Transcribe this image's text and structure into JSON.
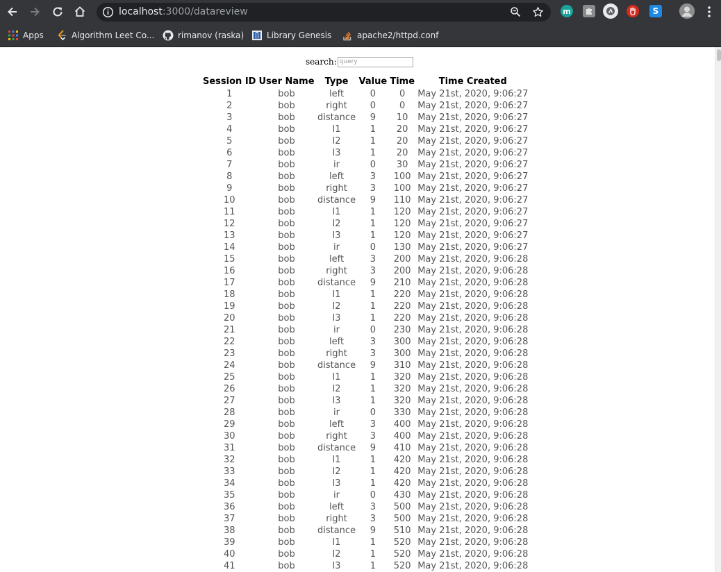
{
  "browser": {
    "url_host": "localhost",
    "url_path": ":3000/datareview",
    "bookmarks": [
      {
        "label": "Apps",
        "icon": "apps-grid-icon"
      },
      {
        "label": "Algorithm Leet Co...",
        "icon": "leetcode-icon"
      },
      {
        "label": "rimanov (raska)",
        "icon": "github-icon"
      },
      {
        "label": "Library Genesis",
        "icon": "library-genesis-icon"
      },
      {
        "label": "apache2/httpd.conf",
        "icon": "stackoverflow-icon"
      }
    ],
    "extensions": [
      {
        "name": "m-extension-icon",
        "letter": "m",
        "color": "#1aa39a"
      },
      {
        "name": "puzzle-extension-icon",
        "letter": "",
        "color": "#8a8b8d"
      },
      {
        "name": "circle-extension-icon",
        "letter": "",
        "color": "#e8eaed"
      },
      {
        "name": "stop-hand-extension-icon",
        "letter": "",
        "color": "#d52b1e"
      },
      {
        "name": "s-extension-icon",
        "letter": "S",
        "color": "#1e88e5"
      }
    ]
  },
  "search": {
    "label": "search:",
    "placeholder": "query"
  },
  "table": {
    "headers": [
      "Session ID",
      "User Name",
      "Type",
      "Value",
      "Time",
      "Time Created"
    ],
    "rows": [
      [
        "1",
        "bob",
        "left",
        "0",
        "0",
        "May 21st, 2020, 9:06:27"
      ],
      [
        "2",
        "bob",
        "right",
        "0",
        "0",
        "May 21st, 2020, 9:06:27"
      ],
      [
        "3",
        "bob",
        "distance",
        "9",
        "10",
        "May 21st, 2020, 9:06:27"
      ],
      [
        "4",
        "bob",
        "l1",
        "1",
        "20",
        "May 21st, 2020, 9:06:27"
      ],
      [
        "5",
        "bob",
        "l2",
        "1",
        "20",
        "May 21st, 2020, 9:06:27"
      ],
      [
        "6",
        "bob",
        "l3",
        "1",
        "20",
        "May 21st, 2020, 9:06:27"
      ],
      [
        "7",
        "bob",
        "ir",
        "0",
        "30",
        "May 21st, 2020, 9:06:27"
      ],
      [
        "8",
        "bob",
        "left",
        "3",
        "100",
        "May 21st, 2020, 9:06:27"
      ],
      [
        "9",
        "bob",
        "right",
        "3",
        "100",
        "May 21st, 2020, 9:06:27"
      ],
      [
        "10",
        "bob",
        "distance",
        "9",
        "110",
        "May 21st, 2020, 9:06:27"
      ],
      [
        "11",
        "bob",
        "l1",
        "1",
        "120",
        "May 21st, 2020, 9:06:27"
      ],
      [
        "12",
        "bob",
        "l2",
        "1",
        "120",
        "May 21st, 2020, 9:06:27"
      ],
      [
        "13",
        "bob",
        "l3",
        "1",
        "120",
        "May 21st, 2020, 9:06:27"
      ],
      [
        "14",
        "bob",
        "ir",
        "0",
        "130",
        "May 21st, 2020, 9:06:27"
      ],
      [
        "15",
        "bob",
        "left",
        "3",
        "200",
        "May 21st, 2020, 9:06:28"
      ],
      [
        "16",
        "bob",
        "right",
        "3",
        "200",
        "May 21st, 2020, 9:06:28"
      ],
      [
        "17",
        "bob",
        "distance",
        "9",
        "210",
        "May 21st, 2020, 9:06:28"
      ],
      [
        "18",
        "bob",
        "l1",
        "1",
        "220",
        "May 21st, 2020, 9:06:28"
      ],
      [
        "19",
        "bob",
        "l2",
        "1",
        "220",
        "May 21st, 2020, 9:06:28"
      ],
      [
        "20",
        "bob",
        "l3",
        "1",
        "220",
        "May 21st, 2020, 9:06:28"
      ],
      [
        "21",
        "bob",
        "ir",
        "0",
        "230",
        "May 21st, 2020, 9:06:28"
      ],
      [
        "22",
        "bob",
        "left",
        "3",
        "300",
        "May 21st, 2020, 9:06:28"
      ],
      [
        "23",
        "bob",
        "right",
        "3",
        "300",
        "May 21st, 2020, 9:06:28"
      ],
      [
        "24",
        "bob",
        "distance",
        "9",
        "310",
        "May 21st, 2020, 9:06:28"
      ],
      [
        "25",
        "bob",
        "l1",
        "1",
        "320",
        "May 21st, 2020, 9:06:28"
      ],
      [
        "26",
        "bob",
        "l2",
        "1",
        "320",
        "May 21st, 2020, 9:06:28"
      ],
      [
        "27",
        "bob",
        "l3",
        "1",
        "320",
        "May 21st, 2020, 9:06:28"
      ],
      [
        "28",
        "bob",
        "ir",
        "0",
        "330",
        "May 21st, 2020, 9:06:28"
      ],
      [
        "29",
        "bob",
        "left",
        "3",
        "400",
        "May 21st, 2020, 9:06:28"
      ],
      [
        "30",
        "bob",
        "right",
        "3",
        "400",
        "May 21st, 2020, 9:06:28"
      ],
      [
        "31",
        "bob",
        "distance",
        "9",
        "410",
        "May 21st, 2020, 9:06:28"
      ],
      [
        "32",
        "bob",
        "l1",
        "1",
        "420",
        "May 21st, 2020, 9:06:28"
      ],
      [
        "33",
        "bob",
        "l2",
        "1",
        "420",
        "May 21st, 2020, 9:06:28"
      ],
      [
        "34",
        "bob",
        "l3",
        "1",
        "420",
        "May 21st, 2020, 9:06:28"
      ],
      [
        "35",
        "bob",
        "ir",
        "0",
        "430",
        "May 21st, 2020, 9:06:28"
      ],
      [
        "36",
        "bob",
        "left",
        "3",
        "500",
        "May 21st, 2020, 9:06:28"
      ],
      [
        "37",
        "bob",
        "right",
        "3",
        "500",
        "May 21st, 2020, 9:06:28"
      ],
      [
        "38",
        "bob",
        "distance",
        "9",
        "510",
        "May 21st, 2020, 9:06:28"
      ],
      [
        "39",
        "bob",
        "l1",
        "1",
        "520",
        "May 21st, 2020, 9:06:28"
      ],
      [
        "40",
        "bob",
        "l2",
        "1",
        "520",
        "May 21st, 2020, 9:06:28"
      ],
      [
        "41",
        "bob",
        "l3",
        "1",
        "520",
        "May 21st, 2020, 9:06:28"
      ]
    ]
  }
}
